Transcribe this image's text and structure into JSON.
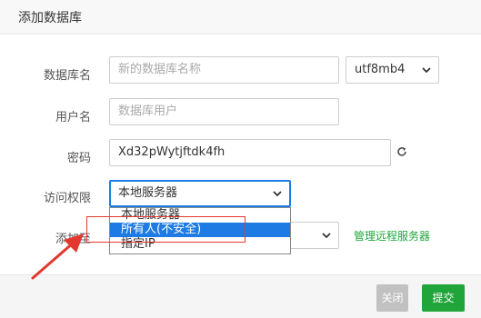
{
  "dialog": {
    "title": "添加数据库"
  },
  "form": {
    "db_name_label": "数据库名",
    "db_name_placeholder": "新的数据库名称",
    "charset_value": "utf8mb4",
    "user_label": "用户名",
    "user_placeholder": "数据库用户",
    "password_label": "密码",
    "password_value": "Xd32pWytjftdk4fh",
    "access_label": "访问权限",
    "access_value": "本地服务器",
    "access_options": [
      "本地服务器",
      "所有人(不安全)",
      "指定IP"
    ],
    "add_to_label": "添加至",
    "manage_remote_link": "管理远程服务器"
  },
  "footer": {
    "close_label": "关闭",
    "submit_label": "提交"
  },
  "colors": {
    "accent_green": "#20a53a",
    "highlight_red": "#e3382e",
    "select_blue": "#1e7be3"
  },
  "icons": {
    "refresh": "refresh-icon",
    "chevron": "chevron-down-icon"
  }
}
